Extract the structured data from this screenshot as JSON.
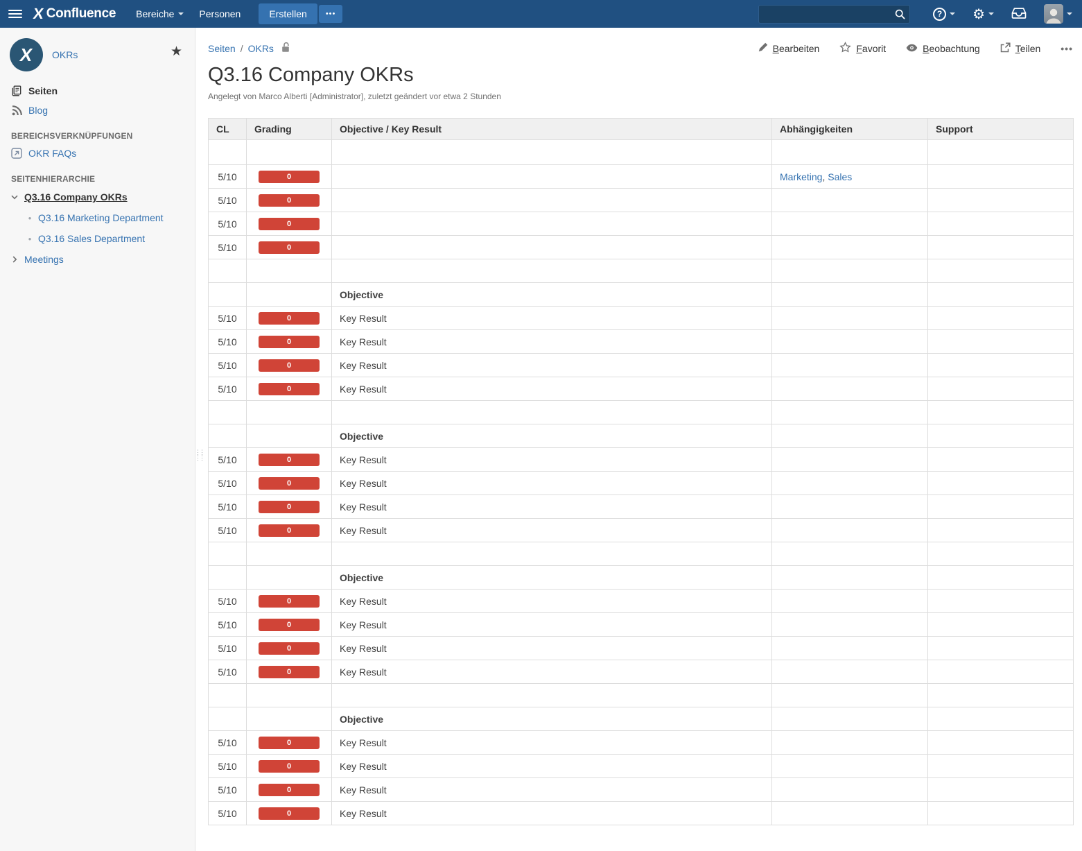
{
  "topnav": {
    "product_name": "Confluence",
    "menu": [
      {
        "label": "Bereiche"
      },
      {
        "label": "Personen"
      }
    ],
    "create_label": "Erstellen",
    "more_label": "•••",
    "search_value": ""
  },
  "sidebar": {
    "space_name": "OKRs",
    "space_logo_letter": "X",
    "nav_pages": "Seiten",
    "nav_blog": "Blog",
    "section_links_heading": "BEREICHSVERKNÜPFUNGEN",
    "link_okr_faqs": "OKR FAQs",
    "section_hierarchy_heading": "SEITENHIERARCHIE",
    "tree_current": "Q3.16 Company OKRs",
    "tree_children": [
      "Q3.16 Marketing Department",
      "Q3.16 Sales Department"
    ],
    "tree_sibling": "Meetings"
  },
  "page": {
    "breadcrumb": [
      "Seiten",
      "OKRs"
    ],
    "breadcrumb_separator": "/",
    "title": "Q3.16 Company OKRs",
    "byline": "Angelegt von Marco Alberti [Administrator], zuletzt geändert vor etwa 2 Stunden",
    "actions": {
      "edit": "Bearbeiten",
      "favorite": "Favorit",
      "watch": "Beobachtung",
      "share": "Teilen",
      "more": "•••"
    }
  },
  "table": {
    "columns": [
      "CL",
      "Grading",
      "Objective / Key Result",
      "Abhängigkeiten",
      "Support"
    ],
    "rows": [
      {
        "type": "empty"
      },
      {
        "type": "kr",
        "cl": "5/10",
        "grading": "0",
        "text": "",
        "deps": [
          "Marketing",
          "Sales"
        ]
      },
      {
        "type": "kr",
        "cl": "5/10",
        "grading": "0",
        "text": ""
      },
      {
        "type": "kr",
        "cl": "5/10",
        "grading": "0",
        "text": ""
      },
      {
        "type": "kr",
        "cl": "5/10",
        "grading": "0",
        "text": ""
      },
      {
        "type": "spacer"
      },
      {
        "type": "objective",
        "text": "Objective"
      },
      {
        "type": "kr",
        "cl": "5/10",
        "grading": "0",
        "text": "Key Result"
      },
      {
        "type": "kr",
        "cl": "5/10",
        "grading": "0",
        "text": "Key Result"
      },
      {
        "type": "kr",
        "cl": "5/10",
        "grading": "0",
        "text": "Key Result"
      },
      {
        "type": "kr",
        "cl": "5/10",
        "grading": "0",
        "text": "Key Result"
      },
      {
        "type": "spacer"
      },
      {
        "type": "objective",
        "text": "Objective"
      },
      {
        "type": "kr",
        "cl": "5/10",
        "grading": "0",
        "text": "Key Result"
      },
      {
        "type": "kr",
        "cl": "5/10",
        "grading": "0",
        "text": "Key Result"
      },
      {
        "type": "kr",
        "cl": "5/10",
        "grading": "0",
        "text": "Key Result"
      },
      {
        "type": "kr",
        "cl": "5/10",
        "grading": "0",
        "text": "Key Result"
      },
      {
        "type": "spacer"
      },
      {
        "type": "objective",
        "text": "Objective"
      },
      {
        "type": "kr",
        "cl": "5/10",
        "grading": "0",
        "text": "Key Result"
      },
      {
        "type": "kr",
        "cl": "5/10",
        "grading": "0",
        "text": "Key Result"
      },
      {
        "type": "kr",
        "cl": "5/10",
        "grading": "0",
        "text": "Key Result"
      },
      {
        "type": "kr",
        "cl": "5/10",
        "grading": "0",
        "text": "Key Result"
      },
      {
        "type": "spacer"
      },
      {
        "type": "objective",
        "text": "Objective"
      },
      {
        "type": "kr",
        "cl": "5/10",
        "grading": "0",
        "text": "Key Result"
      },
      {
        "type": "kr",
        "cl": "5/10",
        "grading": "0",
        "text": "Key Result"
      },
      {
        "type": "kr",
        "cl": "5/10",
        "grading": "0",
        "text": "Key Result"
      },
      {
        "type": "kr",
        "cl": "5/10",
        "grading": "0",
        "text": "Key Result"
      }
    ]
  },
  "colors": {
    "nav_bg": "#205081",
    "accent_blue": "#3572b0",
    "link_blue": "#3572b0",
    "badge_red": "#d04437"
  }
}
